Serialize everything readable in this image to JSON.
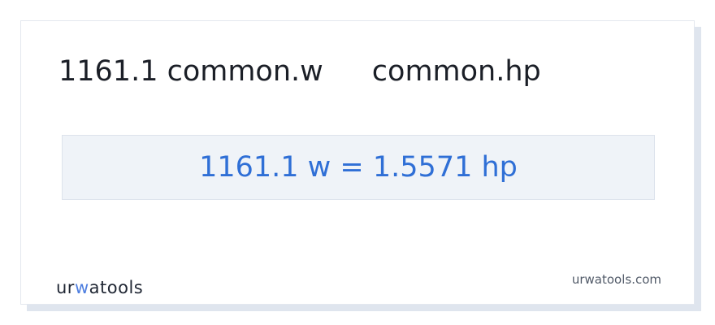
{
  "conversion": {
    "from_label": "1161.1 common.w",
    "to_label": "common.hp",
    "result": "1161.1 w = 1.5571 hp"
  },
  "branding": {
    "logo_prefix": "ur",
    "logo_accent": "w",
    "logo_suffix": "atools",
    "site": "urwatools.com"
  },
  "colors": {
    "accent": "#2f6fd6",
    "result_background": "#eff3f8"
  }
}
